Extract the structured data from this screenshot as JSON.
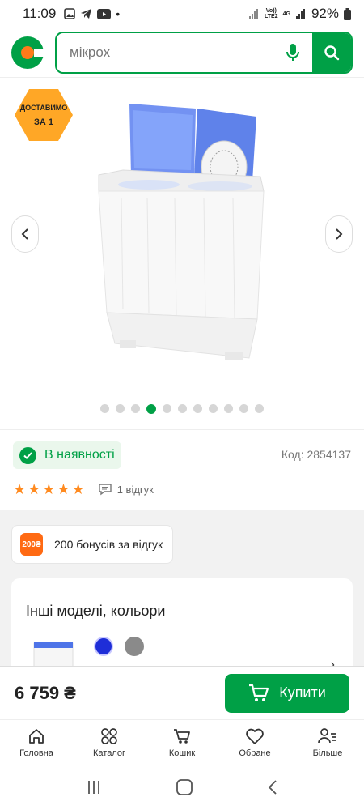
{
  "status_bar": {
    "time": "11:09",
    "network_labels": [
      "Vo))",
      "LTE2",
      "4G"
    ],
    "battery": "92%"
  },
  "header": {
    "search_placeholder": "мікрох"
  },
  "gallery": {
    "badge_line1": "ДОСТАВИМО",
    "badge_line2": "ЗА 1",
    "dots_total": 11,
    "active_dot": 3
  },
  "product": {
    "availability": "В наявності",
    "code": "Код: 2854137",
    "stars": 5,
    "reviews": "1 відгук"
  },
  "bonus": {
    "chip": "200₴",
    "text": "200 бонусів за відгук"
  },
  "models": {
    "title": "Інші моделі, кольори",
    "colors": [
      "#1e2ed8",
      "#8a8a8a"
    ]
  },
  "buy": {
    "price": "6 759 ₴",
    "button": "Купити"
  },
  "nav": {
    "items": [
      {
        "label": "Головна",
        "icon": "home-icon"
      },
      {
        "label": "Каталог",
        "icon": "catalog-icon"
      },
      {
        "label": "Кошик",
        "icon": "cart-icon"
      },
      {
        "label": "Обране",
        "icon": "heart-icon"
      },
      {
        "label": "Більше",
        "icon": "more-icon"
      }
    ]
  },
  "colors": {
    "brand_green": "#00a046",
    "accent_orange": "#ff7a1a"
  }
}
